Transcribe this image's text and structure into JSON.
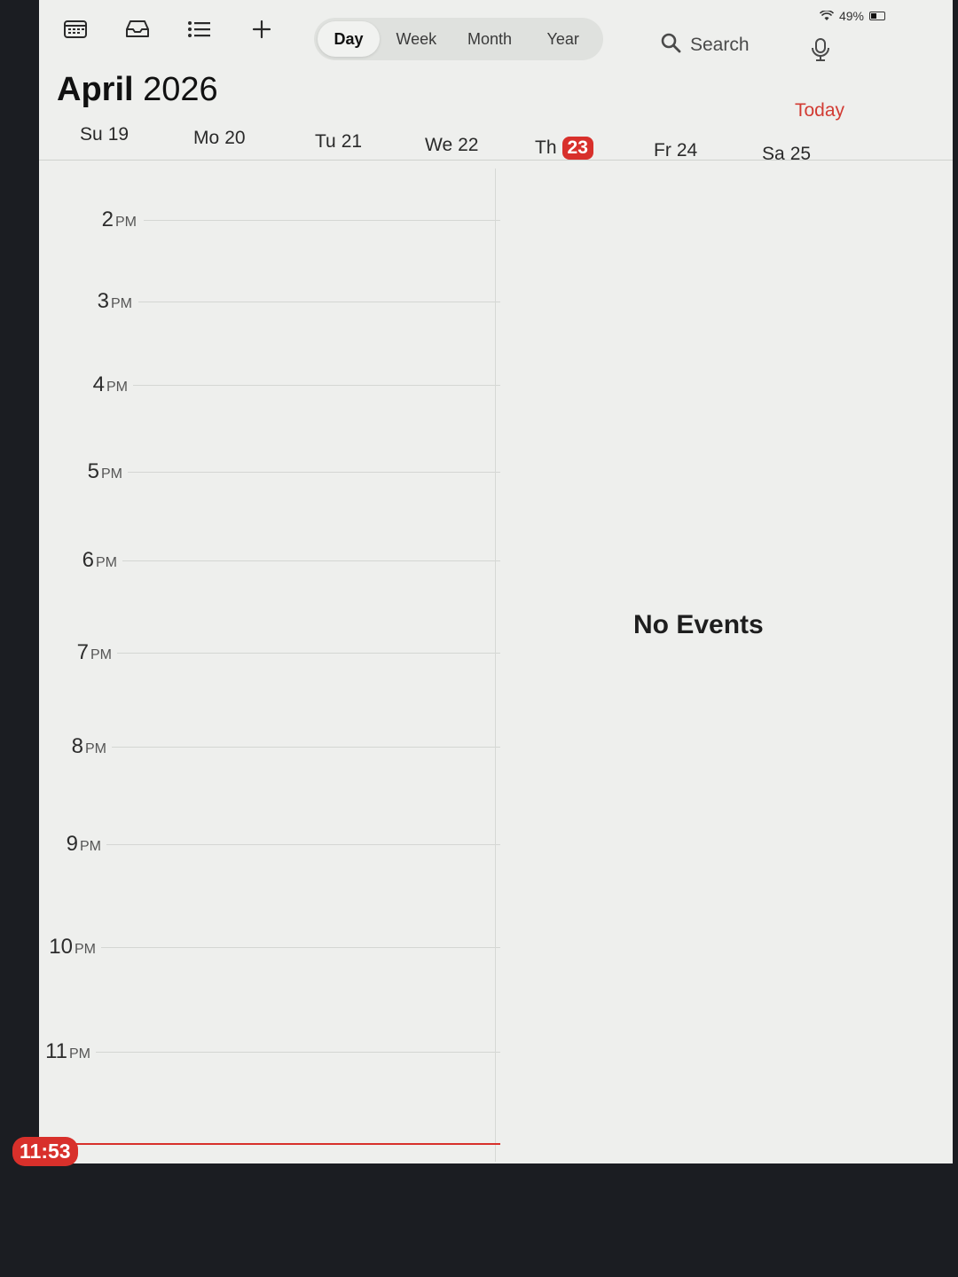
{
  "status_bar": {
    "battery": "49%"
  },
  "toolbar": {
    "view_tabs": [
      "Day",
      "Week",
      "Month",
      "Year"
    ],
    "active_view": "Day",
    "search_placeholder": "Search",
    "icons": [
      "calendars-icon",
      "inbox-icon",
      "list-icon",
      "add-icon",
      "search-icon",
      "microphone-icon"
    ]
  },
  "header": {
    "month": "April",
    "year": "2026",
    "today_label": "Today"
  },
  "week": [
    {
      "dow": "Su",
      "num": "19",
      "today": false
    },
    {
      "dow": "Mo",
      "num": "20",
      "today": false
    },
    {
      "dow": "Tu",
      "num": "21",
      "today": false
    },
    {
      "dow": "We",
      "num": "22",
      "today": false
    },
    {
      "dow": "Th",
      "num": "23",
      "today": true
    },
    {
      "dow": "Fr",
      "num": "24",
      "today": false
    },
    {
      "dow": "Sa",
      "num": "25",
      "today": false
    }
  ],
  "hours": [
    {
      "h": "2",
      "ampm": "PM"
    },
    {
      "h": "3",
      "ampm": "PM"
    },
    {
      "h": "4",
      "ampm": "PM"
    },
    {
      "h": "5",
      "ampm": "PM"
    },
    {
      "h": "6",
      "ampm": "PM"
    },
    {
      "h": "7",
      "ampm": "PM"
    },
    {
      "h": "8",
      "ampm": "PM"
    },
    {
      "h": "9",
      "ampm": "PM"
    },
    {
      "h": "10",
      "ampm": "PM"
    },
    {
      "h": "11",
      "ampm": "PM"
    }
  ],
  "current_time": "11:53",
  "events_panel": {
    "message": "No Events"
  },
  "colors": {
    "accent_red": "#d8302b",
    "today_text": "#d23b33"
  }
}
